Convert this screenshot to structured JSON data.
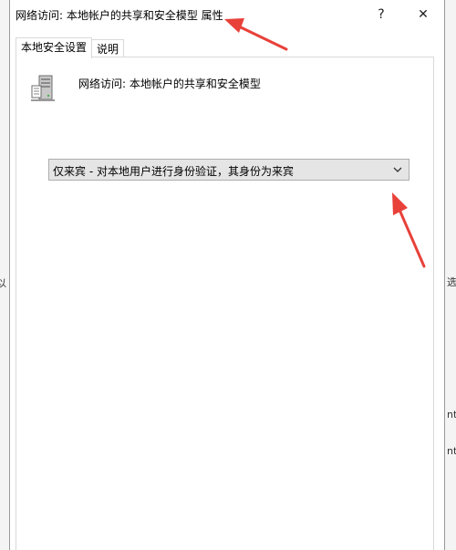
{
  "window": {
    "title": "网络访问: 本地帐户的共享和安全模型 属性",
    "help_glyph": "?",
    "close_glyph": "✕"
  },
  "tabs": [
    {
      "label": "本地安全设置",
      "active": true
    },
    {
      "label": "说明",
      "active": false
    }
  ],
  "policy": {
    "icon": "server-policy-icon",
    "title": "网络访问: 本地帐户的共享和安全模型"
  },
  "dropdown": {
    "selected": "仅来宾 - 对本地用户进行身份验证，其身份为来宾"
  },
  "background": {
    "left_fragment": "以",
    "right_fragments": [
      "选",
      "nt",
      "nt"
    ]
  },
  "colors": {
    "annotation_arrow": "#e8413a",
    "dropdown_bg": "#e5e5e5",
    "tab_border": "#d9d9d9"
  }
}
